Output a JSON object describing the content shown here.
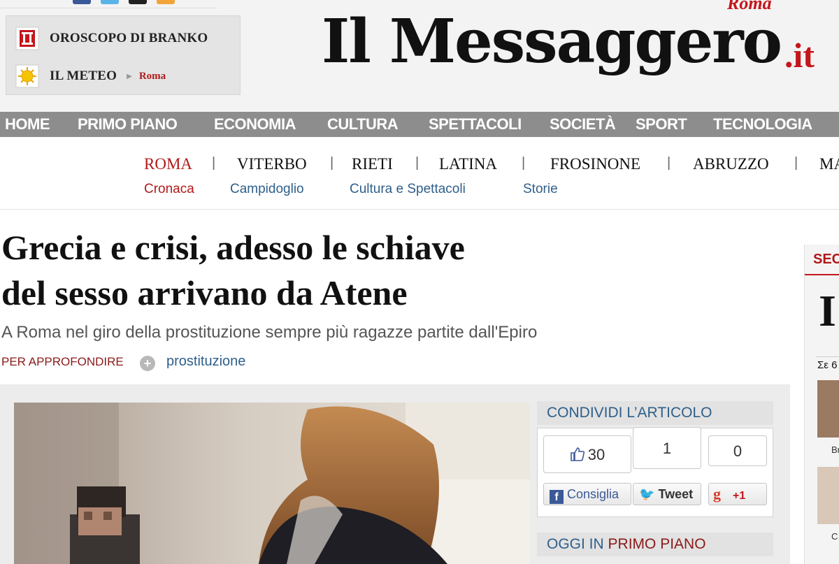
{
  "header": {
    "widgets": [
      {
        "label": "OROSCOPO DI BRANKO",
        "icon": "horoscope-icon"
      },
      {
        "label": "IL METEO",
        "sub": "Roma",
        "icon": "sun-icon"
      }
    ],
    "masthead": {
      "name": "Il Messaggero",
      "tld": ".it",
      "city": "Roma"
    }
  },
  "main_nav": [
    "HOME",
    "PRIMO PIANO",
    "ECONOMIA",
    "CULTURA",
    "SPETTACOLI",
    "SOCIETÀ",
    "SPORT",
    "TECNOLOGIA"
  ],
  "local_nav": {
    "cities": [
      "ROMA",
      "VITERBO",
      "RIETI",
      "LATINA",
      "FROSINONE",
      "ABRUZZO",
      "MA"
    ],
    "active_city": "ROMA",
    "subcategories": [
      "Cronaca",
      "Campidoglio",
      "Cultura e Spettacoli",
      "Storie"
    ]
  },
  "article": {
    "headline_line1": "Grecia e crisi, adesso le schiave",
    "headline_line2": "del sesso arrivano da Atene",
    "subtitle": "A Roma nel giro della prostituzione sempre più ragazze partite dall'Epiro",
    "tag_label": "PER APPROFONDIRE",
    "tag_plus": "+",
    "tag": "prostituzione"
  },
  "share": {
    "title": "CONDIVIDI L’ARTICOLO",
    "facebook_count": "30",
    "twitter_count": "1",
    "gplus_count": "0",
    "facebook_label": "Consiglia",
    "twitter_label": "Tweet",
    "gplus_label": "+1"
  },
  "oggi": {
    "prefix": "OGGI IN",
    "accent": "PRIMO PIANO"
  },
  "right_sidebar": {
    "title": "SEC",
    "logo": "I",
    "text": "Σε 6",
    "captions": [
      "Br",
      "C"
    ]
  },
  "colors": {
    "accent_red": "#c4161c",
    "link_blue": "#2f5f8a",
    "nav_grey": "#8d8d8d"
  }
}
